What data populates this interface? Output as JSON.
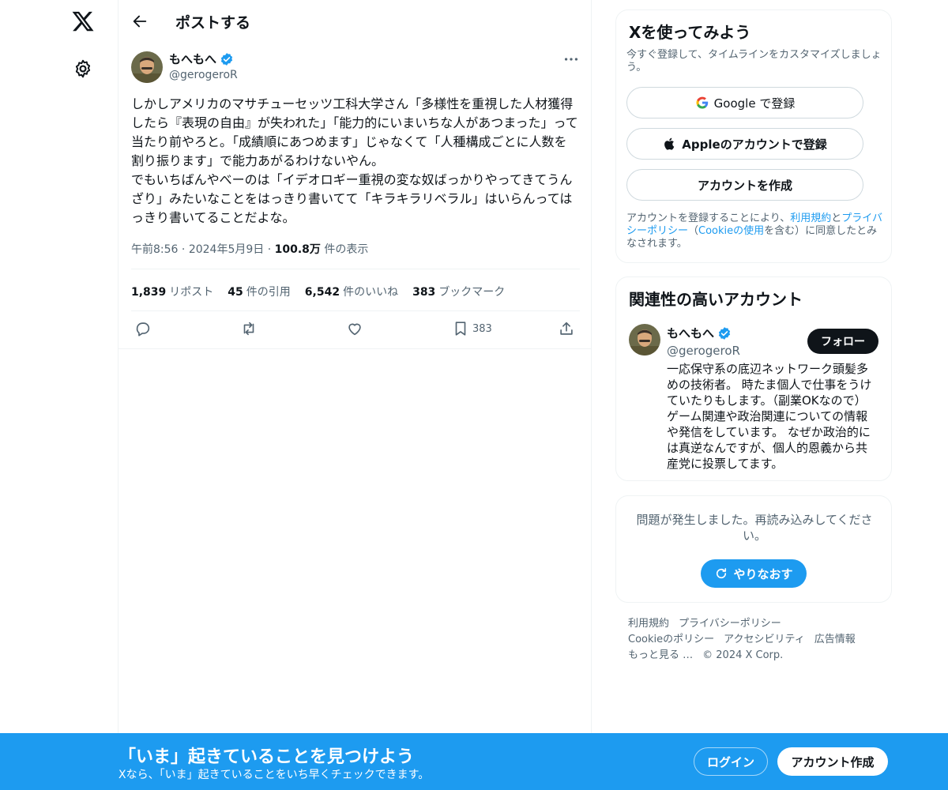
{
  "header": {
    "title": "ポストする"
  },
  "tweet": {
    "author_name": "もへもへ",
    "author_handle": "@gerogeroR",
    "text": "しかしアメリカのマサチューセッツ工科大学さん「多様性を重視した人材獲得したら『表現の自由』が失われた」「能力的にいまいちな人があつまった」って当たり前やろと。「成績順にあつめます」じゃなくて「人種構成ごとに人数を割り振ります」で能力あがるわけないやん。\nでもいちばんやべーのは「イデオロギー重視の変な奴ばっかりやってきてうんざり」みたいなことをはっきり書いてて「キラキラリベラル」はいらんってはっきり書いてることだよな。",
    "time": "午前8:56",
    "date": "2024年5月9日",
    "views_value": "100.8万",
    "views_label": "件の表示",
    "stats": [
      {
        "n": "1,839",
        "label": "リポスト"
      },
      {
        "n": "45",
        "label": "件の引用"
      },
      {
        "n": "6,542",
        "label": "件のいいね"
      },
      {
        "n": "383",
        "label": "ブックマーク"
      }
    ],
    "bookmark_count": "383"
  },
  "signup_card": {
    "title": "Xを使ってみよう",
    "subtitle": "今すぐ登録して、タイムラインをカスタマイズしましょう。",
    "google_label": "Google で登録",
    "apple_label": "Appleのアカウントで登録",
    "create_label": "アカウントを作成",
    "terms_1": "アカウントを登録することにより、",
    "terms_link_1": "利用規約",
    "terms_2": "と",
    "terms_link_2": "プライバシーポリシー",
    "terms_3": "（",
    "terms_link_3": "Cookieの使用",
    "terms_4": "を含む）に同意したとみなされます。"
  },
  "related_card": {
    "title": "関連性の高いアカウント",
    "name": "もへもへ",
    "handle": "@gerogeroR",
    "follow_label": "フォロー",
    "bio": "一応保守系の底辺ネットワーク頭髪多めの技術者。 時たま個人で仕事をうけていたりもします。（副業OKなので） ゲーム関連や政治関連についての情報や発信をしています。 なぜか政治的には真逆なんですが、個人的恩義から共産党に投票してます。"
  },
  "error_card": {
    "message": "問題が発生しました。再読み込みしてください。",
    "retry_label": "やりなおす"
  },
  "footer": {
    "links": [
      "利用規約",
      "プライバシーポリシー",
      "Cookieのポリシー",
      "アクセシビリティ",
      "広告情報",
      "もっと見る …",
      "© 2024 X Corp."
    ]
  },
  "banner": {
    "title": "「いま」起きていることを見つけよう",
    "subtitle": "Xなら、「いま」起きていることをいち早くチェックできます。",
    "login_label": "ログイン",
    "signup_label": "アカウント作成"
  },
  "colors": {
    "accent": "#1d9bf0",
    "text": "#0f1419",
    "secondary": "#536471",
    "border": "#eff3f4"
  }
}
